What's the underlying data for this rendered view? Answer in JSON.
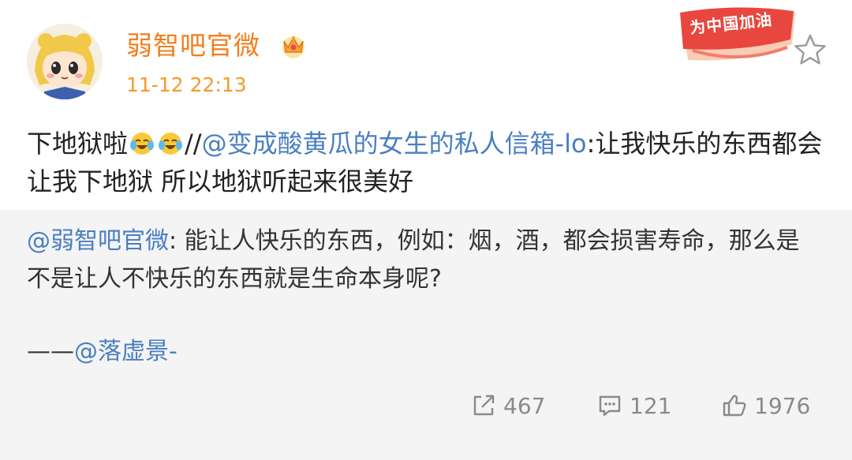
{
  "user": {
    "name": "弱智吧官微",
    "timestamp": "11-12 22:13",
    "avatar_icon": "anime-girl-avatar",
    "vip_icon": "crown-badge-icon"
  },
  "badge": {
    "text": "为中国加油",
    "color": "#e8473f"
  },
  "post": {
    "text_before_emoji": "下地狱啦",
    "emoji": "crying-laughing-face",
    "separator": "//",
    "mention": "@变成酸黄瓜的女生的私人信箱-lo",
    "text_after_mention": ":让我快乐的东西都会让我下地狱 所以地狱听起来很美好"
  },
  "repost": {
    "mention": "@弱智吧官微",
    "text": ": 能让人快乐的东西，例如：烟，酒，都会损害寿命，那么是不是让人不快乐的东西就是生命本身呢?",
    "sign_prefix": "——",
    "sign_mention": "@落虚景-"
  },
  "actions": {
    "share_count": "467",
    "comment_count": "121",
    "like_count": "1976"
  },
  "colors": {
    "accent_orange": "#f37e1e",
    "link_blue": "#4a7fc1",
    "repost_bg": "#f4f4f4",
    "action_gray": "#8a8a8a"
  }
}
